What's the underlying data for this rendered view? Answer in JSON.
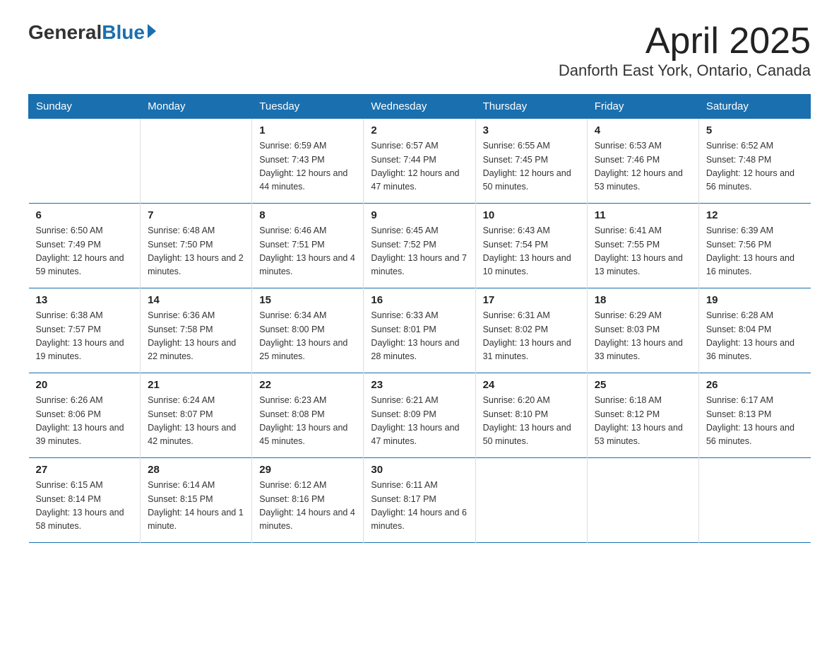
{
  "logo": {
    "general": "General",
    "blue": "Blue",
    "tagline": "Blue"
  },
  "header": {
    "month": "April 2025",
    "location": "Danforth East York, Ontario, Canada"
  },
  "days_of_week": [
    "Sunday",
    "Monday",
    "Tuesday",
    "Wednesday",
    "Thursday",
    "Friday",
    "Saturday"
  ],
  "weeks": [
    [
      {
        "day": "",
        "info": ""
      },
      {
        "day": "",
        "info": ""
      },
      {
        "day": "1",
        "info": "Sunrise: 6:59 AM\nSunset: 7:43 PM\nDaylight: 12 hours\nand 44 minutes."
      },
      {
        "day": "2",
        "info": "Sunrise: 6:57 AM\nSunset: 7:44 PM\nDaylight: 12 hours\nand 47 minutes."
      },
      {
        "day": "3",
        "info": "Sunrise: 6:55 AM\nSunset: 7:45 PM\nDaylight: 12 hours\nand 50 minutes."
      },
      {
        "day": "4",
        "info": "Sunrise: 6:53 AM\nSunset: 7:46 PM\nDaylight: 12 hours\nand 53 minutes."
      },
      {
        "day": "5",
        "info": "Sunrise: 6:52 AM\nSunset: 7:48 PM\nDaylight: 12 hours\nand 56 minutes."
      }
    ],
    [
      {
        "day": "6",
        "info": "Sunrise: 6:50 AM\nSunset: 7:49 PM\nDaylight: 12 hours\nand 59 minutes."
      },
      {
        "day": "7",
        "info": "Sunrise: 6:48 AM\nSunset: 7:50 PM\nDaylight: 13 hours\nand 2 minutes."
      },
      {
        "day": "8",
        "info": "Sunrise: 6:46 AM\nSunset: 7:51 PM\nDaylight: 13 hours\nand 4 minutes."
      },
      {
        "day": "9",
        "info": "Sunrise: 6:45 AM\nSunset: 7:52 PM\nDaylight: 13 hours\nand 7 minutes."
      },
      {
        "day": "10",
        "info": "Sunrise: 6:43 AM\nSunset: 7:54 PM\nDaylight: 13 hours\nand 10 minutes."
      },
      {
        "day": "11",
        "info": "Sunrise: 6:41 AM\nSunset: 7:55 PM\nDaylight: 13 hours\nand 13 minutes."
      },
      {
        "day": "12",
        "info": "Sunrise: 6:39 AM\nSunset: 7:56 PM\nDaylight: 13 hours\nand 16 minutes."
      }
    ],
    [
      {
        "day": "13",
        "info": "Sunrise: 6:38 AM\nSunset: 7:57 PM\nDaylight: 13 hours\nand 19 minutes."
      },
      {
        "day": "14",
        "info": "Sunrise: 6:36 AM\nSunset: 7:58 PM\nDaylight: 13 hours\nand 22 minutes."
      },
      {
        "day": "15",
        "info": "Sunrise: 6:34 AM\nSunset: 8:00 PM\nDaylight: 13 hours\nand 25 minutes."
      },
      {
        "day": "16",
        "info": "Sunrise: 6:33 AM\nSunset: 8:01 PM\nDaylight: 13 hours\nand 28 minutes."
      },
      {
        "day": "17",
        "info": "Sunrise: 6:31 AM\nSunset: 8:02 PM\nDaylight: 13 hours\nand 31 minutes."
      },
      {
        "day": "18",
        "info": "Sunrise: 6:29 AM\nSunset: 8:03 PM\nDaylight: 13 hours\nand 33 minutes."
      },
      {
        "day": "19",
        "info": "Sunrise: 6:28 AM\nSunset: 8:04 PM\nDaylight: 13 hours\nand 36 minutes."
      }
    ],
    [
      {
        "day": "20",
        "info": "Sunrise: 6:26 AM\nSunset: 8:06 PM\nDaylight: 13 hours\nand 39 minutes."
      },
      {
        "day": "21",
        "info": "Sunrise: 6:24 AM\nSunset: 8:07 PM\nDaylight: 13 hours\nand 42 minutes."
      },
      {
        "day": "22",
        "info": "Sunrise: 6:23 AM\nSunset: 8:08 PM\nDaylight: 13 hours\nand 45 minutes."
      },
      {
        "day": "23",
        "info": "Sunrise: 6:21 AM\nSunset: 8:09 PM\nDaylight: 13 hours\nand 47 minutes."
      },
      {
        "day": "24",
        "info": "Sunrise: 6:20 AM\nSunset: 8:10 PM\nDaylight: 13 hours\nand 50 minutes."
      },
      {
        "day": "25",
        "info": "Sunrise: 6:18 AM\nSunset: 8:12 PM\nDaylight: 13 hours\nand 53 minutes."
      },
      {
        "day": "26",
        "info": "Sunrise: 6:17 AM\nSunset: 8:13 PM\nDaylight: 13 hours\nand 56 minutes."
      }
    ],
    [
      {
        "day": "27",
        "info": "Sunrise: 6:15 AM\nSunset: 8:14 PM\nDaylight: 13 hours\nand 58 minutes."
      },
      {
        "day": "28",
        "info": "Sunrise: 6:14 AM\nSunset: 8:15 PM\nDaylight: 14 hours\nand 1 minute."
      },
      {
        "day": "29",
        "info": "Sunrise: 6:12 AM\nSunset: 8:16 PM\nDaylight: 14 hours\nand 4 minutes."
      },
      {
        "day": "30",
        "info": "Sunrise: 6:11 AM\nSunset: 8:17 PM\nDaylight: 14 hours\nand 6 minutes."
      },
      {
        "day": "",
        "info": ""
      },
      {
        "day": "",
        "info": ""
      },
      {
        "day": "",
        "info": ""
      }
    ]
  ]
}
